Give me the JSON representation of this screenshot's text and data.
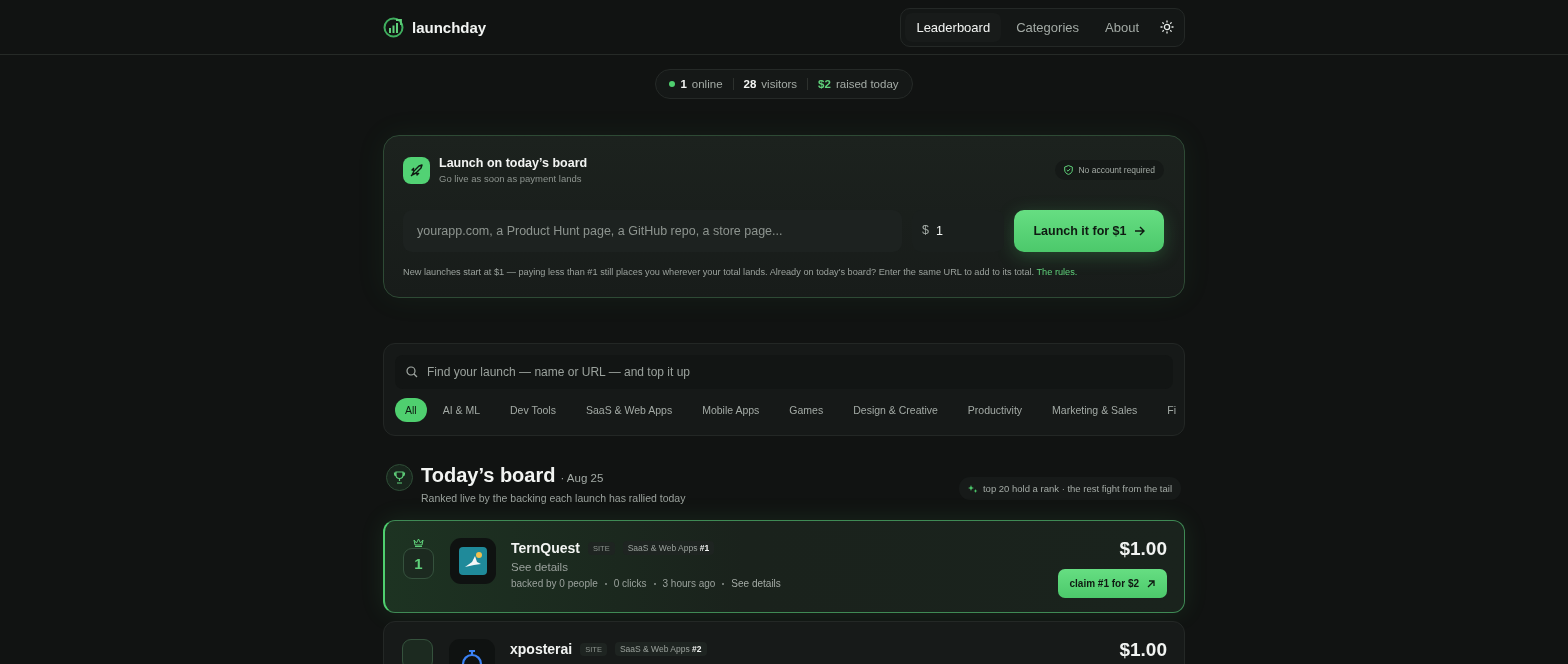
{
  "header": {
    "logo": "launchday",
    "nav": [
      {
        "label": "Leaderboard",
        "selected": true
      },
      {
        "label": "Categories",
        "selected": false
      },
      {
        "label": "About",
        "selected": false
      }
    ]
  },
  "stats": {
    "online": "1",
    "online_label": "online",
    "visitors": "28",
    "visitors_label": "visitors",
    "raised": "$2",
    "raised_label": "raised today"
  },
  "launch": {
    "title": "Launch on today’s board",
    "subtitle": "Go live as soon as payment lands",
    "badge": "No account required",
    "url_placeholder": "yourapp.com, a Product Hunt page, a GitHub repo, a store page...",
    "currency": "$",
    "amount": "1",
    "button": "Launch it for $1",
    "note": "New launches start at $1 — paying less than #1 still places you wherever your total lands. Already on today's board? Enter the same URL to add to its total.",
    "rules_link": "The rules."
  },
  "filter": {
    "search_placeholder": "Find your launch — name or URL — and top it up",
    "categories": [
      {
        "label": "All",
        "selected": true
      },
      {
        "label": "AI & ML",
        "selected": false
      },
      {
        "label": "Dev Tools",
        "selected": false
      },
      {
        "label": "SaaS & Web Apps",
        "selected": false
      },
      {
        "label": "Mobile Apps",
        "selected": false
      },
      {
        "label": "Games",
        "selected": false
      },
      {
        "label": "Design & Creative",
        "selected": false
      },
      {
        "label": "Productivity",
        "selected": false
      },
      {
        "label": "Marketing & Sales",
        "selected": false
      },
      {
        "label": "Fi",
        "selected": false
      }
    ]
  },
  "board": {
    "title": "Today’s board",
    "date": "· Aug 25",
    "subtitle": "Ranked live by the backing each launch has rallied today",
    "hint": "top 20 hold a rank · the rest fight from the tail",
    "launches": [
      {
        "rank": "1",
        "top": true,
        "name": "TernQuest",
        "type": "SITE",
        "category": "SaaS & Web Apps",
        "category_rank": "#1",
        "description": "See details",
        "backers": "backed by 0 people",
        "clicks": "0 clicks",
        "time": "3 hours ago",
        "details_link": "See details",
        "amount": "$1.00",
        "claim": "claim #1 for $2"
      },
      {
        "top": false,
        "name": "xposterai",
        "type": "SITE",
        "category": "SaaS & Web Apps",
        "category_rank": "#2",
        "amount": "$1.00"
      }
    ]
  }
}
